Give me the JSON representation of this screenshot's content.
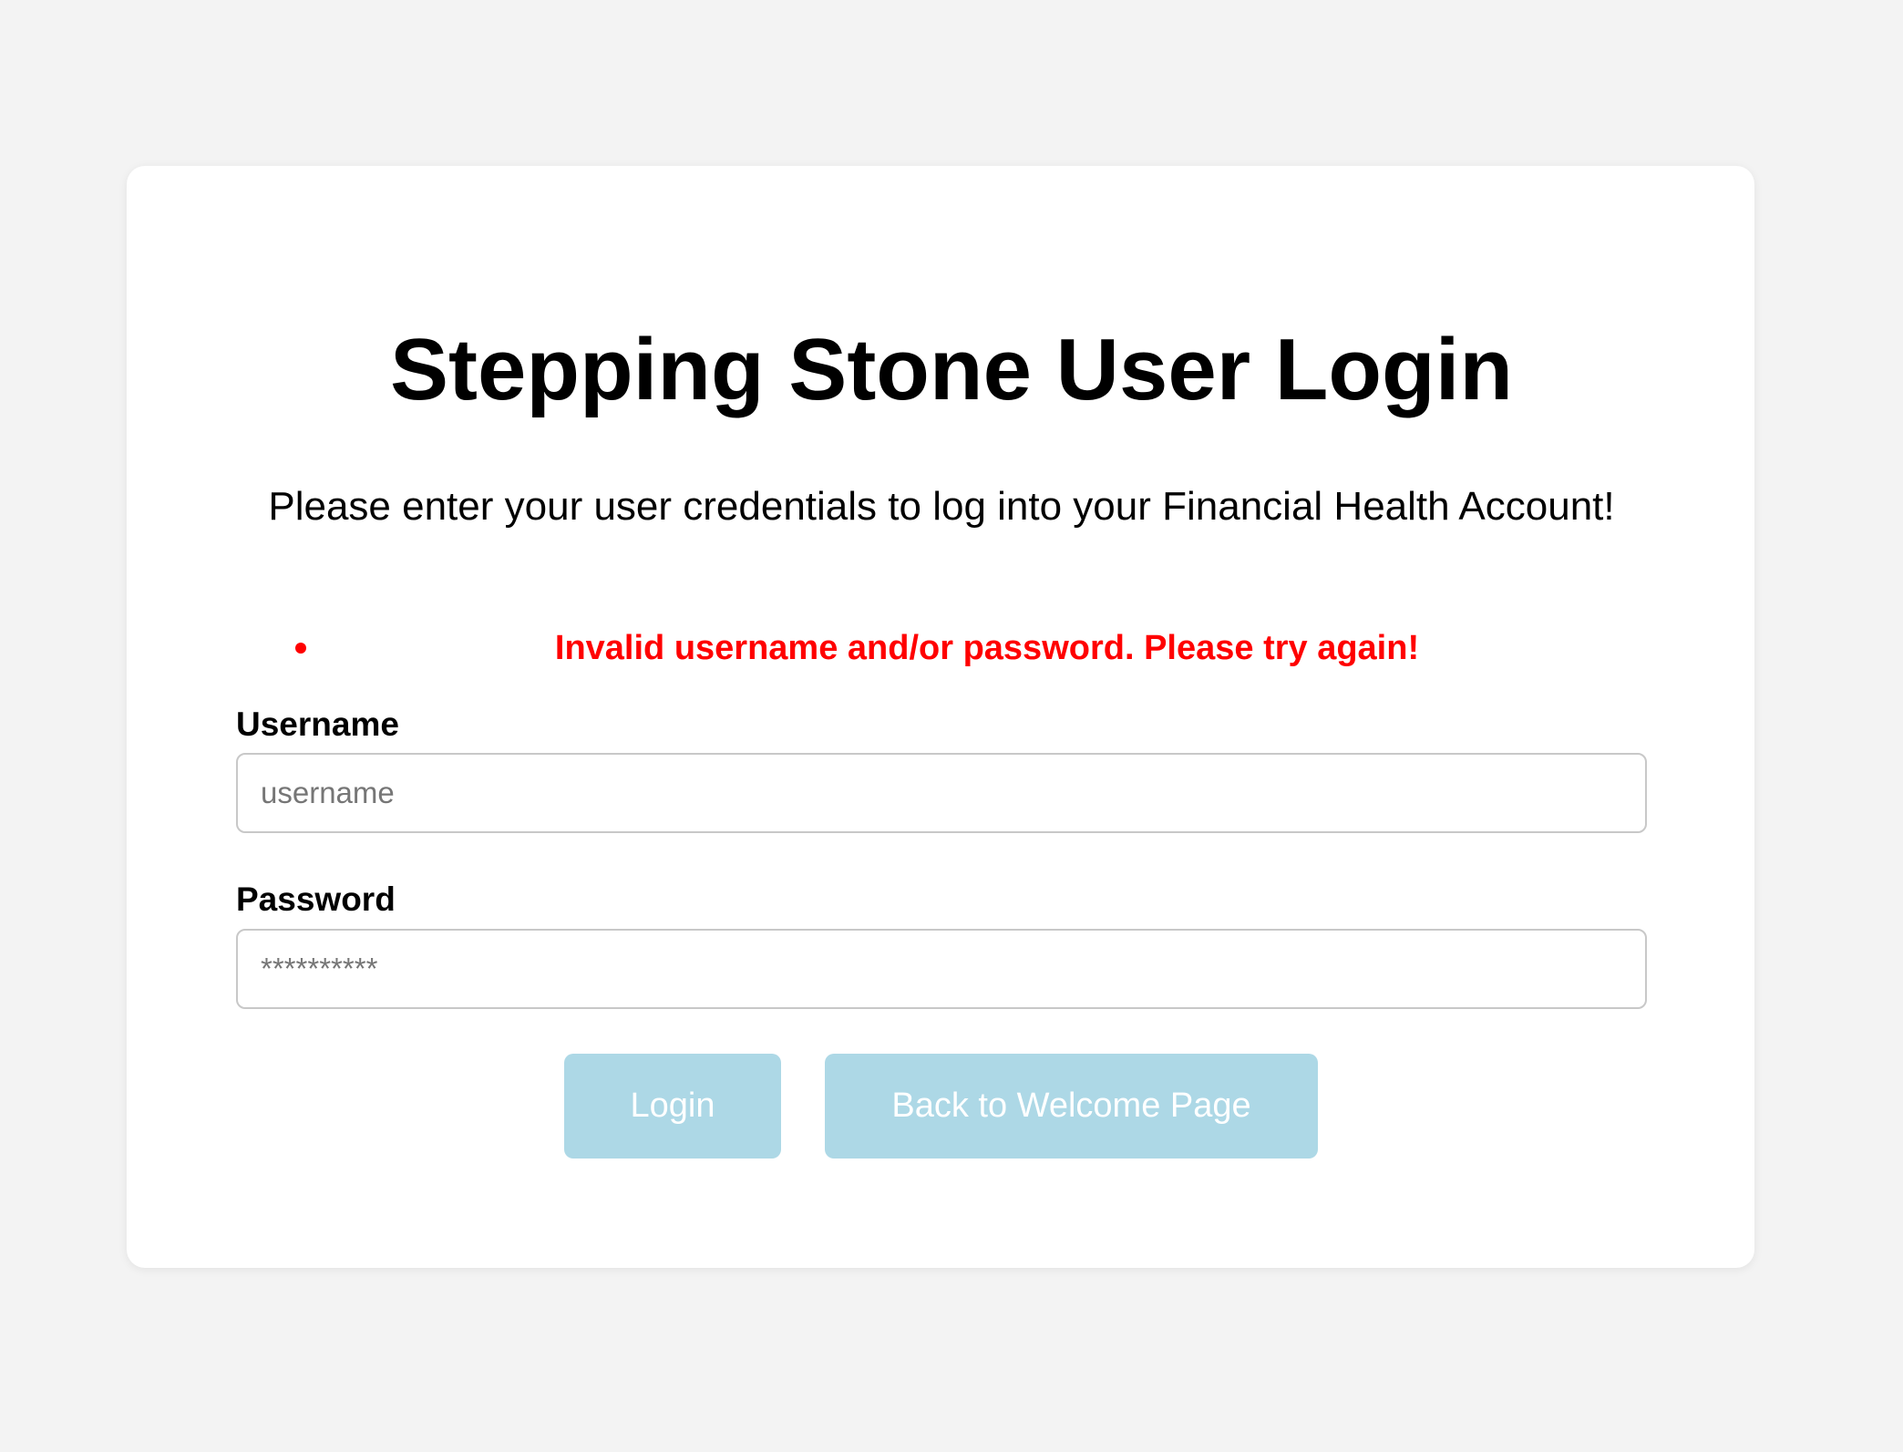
{
  "page": {
    "title": "Stepping Stone User Login",
    "subtitle": "Please enter your user credentials to log into your Financial Health Account!"
  },
  "error": {
    "message": "Invalid username and/or password. Please try again!",
    "color": "#ff0000"
  },
  "form": {
    "username_label": "Username",
    "username_placeholder": "username",
    "username_value": "",
    "password_label": "Password",
    "password_placeholder": "**********",
    "password_value": ""
  },
  "buttons": {
    "login_label": "Login",
    "back_label": "Back to Welcome Page",
    "color": "#add8e6"
  },
  "colors": {
    "background": "#f3f3f3",
    "card": "#ffffff"
  }
}
